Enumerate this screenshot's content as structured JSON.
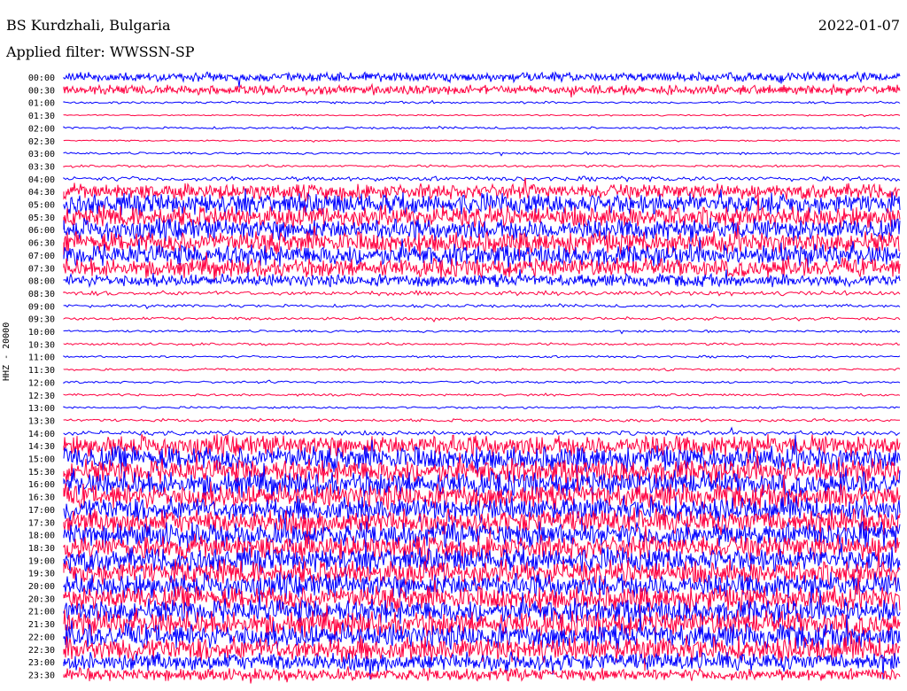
{
  "header": {
    "station": "BS Kurdzhali, Bulgaria",
    "date": "2022-01-07",
    "filter": "Applied filter: WWSSN-SP"
  },
  "chart_data": {
    "type": "line",
    "title": "BS Kurdzhali, Bulgaria",
    "channel_label": "HHZ - 20000",
    "colors": [
      "#0000ff",
      "#ff0040"
    ],
    "rows": [
      {
        "time": "00:00",
        "amp": 6,
        "color": "#0000ff"
      },
      {
        "time": "00:30",
        "amp": 6,
        "color": "#ff0040"
      },
      {
        "time": "01:00",
        "amp": 1.5,
        "color": "#0000ff"
      },
      {
        "time": "01:30",
        "amp": 1,
        "color": "#ff0040"
      },
      {
        "time": "02:00",
        "amp": 1.5,
        "color": "#0000ff"
      },
      {
        "time": "02:30",
        "amp": 1,
        "color": "#ff0040"
      },
      {
        "time": "03:00",
        "amp": 1.5,
        "color": "#0000ff"
      },
      {
        "time": "03:30",
        "amp": 1.5,
        "color": "#ff0040"
      },
      {
        "time": "04:00",
        "amp": 3,
        "color": "#0000ff"
      },
      {
        "time": "04:30",
        "amp": 10,
        "color": "#ff0040"
      },
      {
        "time": "05:00",
        "amp": 14,
        "color": "#0000ff"
      },
      {
        "time": "05:30",
        "amp": 14,
        "color": "#ff0040"
      },
      {
        "time": "06:00",
        "amp": 14,
        "color": "#0000ff"
      },
      {
        "time": "06:30",
        "amp": 14,
        "color": "#ff0040"
      },
      {
        "time": "07:00",
        "amp": 14,
        "color": "#0000ff"
      },
      {
        "time": "07:30",
        "amp": 12,
        "color": "#ff0040"
      },
      {
        "time": "08:00",
        "amp": 8,
        "color": "#0000ff"
      },
      {
        "time": "08:30",
        "amp": 3,
        "color": "#ff0040"
      },
      {
        "time": "09:00",
        "amp": 2,
        "color": "#0000ff"
      },
      {
        "time": "09:30",
        "amp": 2,
        "color": "#ff0040"
      },
      {
        "time": "10:00",
        "amp": 1.5,
        "color": "#0000ff"
      },
      {
        "time": "10:30",
        "amp": 1.5,
        "color": "#ff0040"
      },
      {
        "time": "11:00",
        "amp": 1.5,
        "color": "#0000ff"
      },
      {
        "time": "11:30",
        "amp": 1.5,
        "color": "#ff0040"
      },
      {
        "time": "12:00",
        "amp": 1.5,
        "color": "#0000ff"
      },
      {
        "time": "12:30",
        "amp": 1.5,
        "color": "#ff0040"
      },
      {
        "time": "13:00",
        "amp": 1.5,
        "color": "#0000ff"
      },
      {
        "time": "13:30",
        "amp": 2,
        "color": "#ff0040"
      },
      {
        "time": "14:00",
        "amp": 3,
        "color": "#0000ff"
      },
      {
        "time": "14:30",
        "amp": 14,
        "color": "#ff0040"
      },
      {
        "time": "15:00",
        "amp": 16,
        "color": "#0000ff"
      },
      {
        "time": "15:30",
        "amp": 16,
        "color": "#ff0040"
      },
      {
        "time": "16:00",
        "amp": 16,
        "color": "#0000ff"
      },
      {
        "time": "16:30",
        "amp": 16,
        "color": "#ff0040"
      },
      {
        "time": "17:00",
        "amp": 16,
        "color": "#0000ff"
      },
      {
        "time": "17:30",
        "amp": 16,
        "color": "#ff0040"
      },
      {
        "time": "18:00",
        "amp": 16,
        "color": "#0000ff"
      },
      {
        "time": "18:30",
        "amp": 16,
        "color": "#ff0040"
      },
      {
        "time": "19:00",
        "amp": 16,
        "color": "#0000ff"
      },
      {
        "time": "19:30",
        "amp": 16,
        "color": "#ff0040"
      },
      {
        "time": "20:00",
        "amp": 16,
        "color": "#0000ff"
      },
      {
        "time": "20:30",
        "amp": 16,
        "color": "#ff0040"
      },
      {
        "time": "21:00",
        "amp": 16,
        "color": "#0000ff"
      },
      {
        "time": "21:30",
        "amp": 16,
        "color": "#ff0040"
      },
      {
        "time": "22:00",
        "amp": 16,
        "color": "#0000ff"
      },
      {
        "time": "22:30",
        "amp": 16,
        "color": "#ff0040"
      },
      {
        "time": "23:00",
        "amp": 12,
        "color": "#0000ff"
      },
      {
        "time": "23:30",
        "amp": 8,
        "color": "#ff0040"
      }
    ]
  }
}
